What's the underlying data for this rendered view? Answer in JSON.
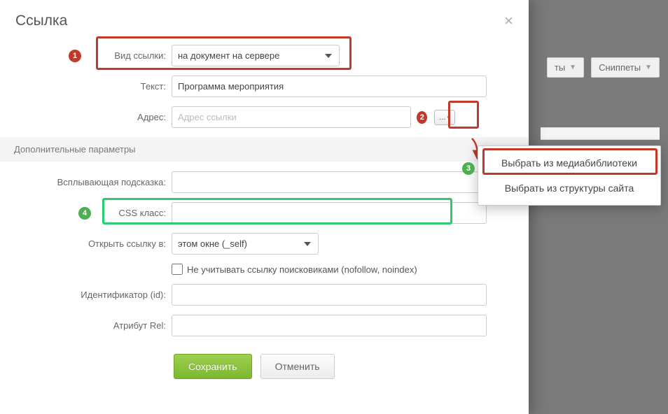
{
  "dialog": {
    "title": "Ссылка",
    "close": "×"
  },
  "fields": {
    "link_type": {
      "label": "Вид ссылки:",
      "value": "на документ на сервере"
    },
    "text": {
      "label": "Текст:",
      "value": "Программа мероприятия"
    },
    "address": {
      "label": "Адрес:",
      "placeholder": "Адрес ссылки",
      "browse": "..."
    },
    "section_additional": "Дополнительные параметры",
    "tooltip": {
      "label": "Всплывающая подсказка:"
    },
    "css_class": {
      "label": "CSS класс:"
    },
    "open_in": {
      "label": "Открыть ссылку в:",
      "value": "этом окне (_self)"
    },
    "nofollow": {
      "label": "Не учитывать ссылку поисковиками (nofollow, noindex)"
    },
    "identifier": {
      "label": "Идентификатор (id):"
    },
    "rel": {
      "label": "Атрибут Rel:"
    }
  },
  "buttons": {
    "save": "Сохранить",
    "cancel": "Отменить"
  },
  "dropdown": {
    "media": "Выбрать из медиабиблиотеки",
    "structure": "Выбрать из структуры сайта"
  },
  "bg_toolbar": {
    "btn1_suffix": "ты",
    "btn2": "Сниппеты"
  },
  "markers": {
    "m1": "1",
    "m2": "2",
    "m3": "3",
    "m4": "4"
  }
}
